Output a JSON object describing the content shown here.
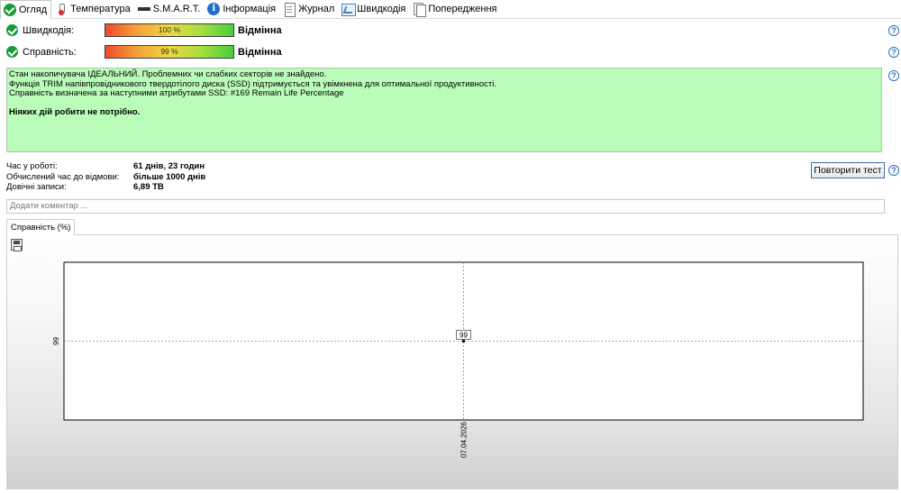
{
  "tabs": [
    {
      "label": "Огляд",
      "icon": "check-circle-icon",
      "active": true
    },
    {
      "label": "Температура",
      "icon": "thermometer-icon"
    },
    {
      "label": "S.M.A.R.T.",
      "icon": "drive-icon"
    },
    {
      "label": "Інформація",
      "icon": "info-icon"
    },
    {
      "label": "Журнал",
      "icon": "document-icon"
    },
    {
      "label": "Швидкодія",
      "icon": "chart-icon"
    },
    {
      "label": "Попередження",
      "icon": "documents-icon"
    }
  ],
  "performance": {
    "label": "Швидкодія:",
    "value": "100 %",
    "fraction": 1.0,
    "verdict": "Відмінна"
  },
  "health": {
    "label": "Справність:",
    "value": "99 %",
    "fraction": 0.99,
    "verdict": "Відмінна"
  },
  "status_lines": [
    "Стан накопичувача ІДЕАЛЬНИЙ. Проблемних чи слабких секторів не знайдено.",
    "Функція TRIM напівпровідникового твердотілого диска (SSD) підтримується та увімкнена для оптимальної продуктивності.",
    "Справність визначена за наступними атрибутами SSD:  #169 Remain Life Percentage"
  ],
  "status_action": "Ніяких дій робити не потрібно.",
  "status_color": "#b9fdb9",
  "info": {
    "uptime_label": "Час у роботі:",
    "uptime_value": "61 днів, 23 годин",
    "ttf_label": "Обчислений час до відмови:",
    "ttf_value": "більше 1000 днів",
    "writes_label": "Довічні записи:",
    "writes_value": "6,89 ТВ"
  },
  "retest_button": "Повторити тест",
  "comment_placeholder": "Додати коментар ...",
  "help_symbol": "?",
  "chart_tab": "Справність (%)",
  "chart_data": {
    "type": "scatter",
    "title": "",
    "xlabel": "",
    "ylabel": "",
    "x": [
      "07.04.2026"
    ],
    "y": [
      99
    ],
    "y_tick_labels": [
      "99"
    ],
    "x_tick_labels": [
      "07.04.2026"
    ],
    "data_labels": [
      "99"
    ],
    "grid": "dashed crosshair",
    "legend": "none"
  }
}
